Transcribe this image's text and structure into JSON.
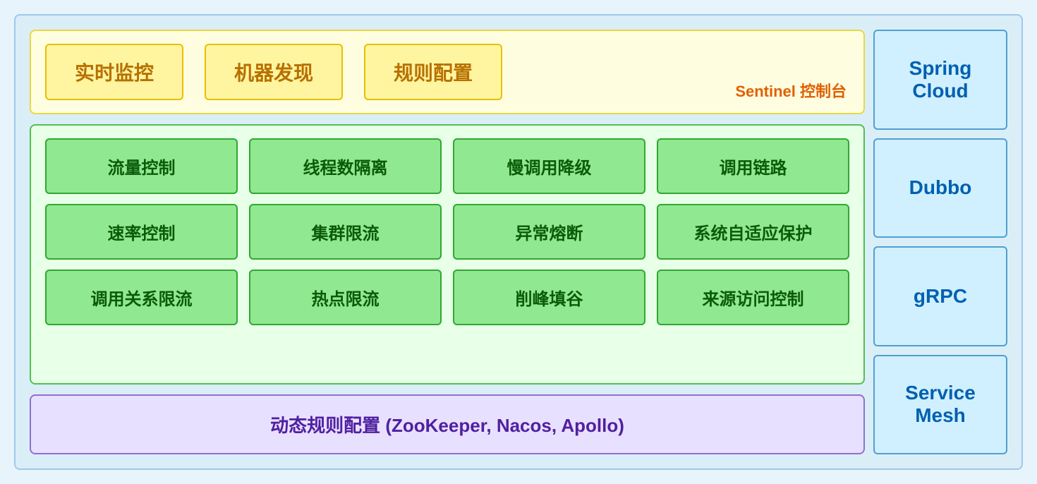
{
  "sentinel": {
    "boxes": [
      {
        "label": "实时监控"
      },
      {
        "label": "机器发现"
      },
      {
        "label": "规则配置"
      }
    ],
    "panel_label": "Sentinel 控制台"
  },
  "features": {
    "rows": [
      [
        {
          "label": "流量控制"
        },
        {
          "label": "线程数隔离"
        },
        {
          "label": "慢调用降级"
        },
        {
          "label": "调用链路"
        }
      ],
      [
        {
          "label": "速率控制"
        },
        {
          "label": "集群限流"
        },
        {
          "label": "异常熔断"
        },
        {
          "label": "系统自适应保护"
        }
      ],
      [
        {
          "label": "调用关系限流"
        },
        {
          "label": "热点限流"
        },
        {
          "label": "削峰填谷"
        },
        {
          "label": "来源访问控制"
        }
      ]
    ]
  },
  "dynamic": {
    "label": "动态规则配置 (ZooKeeper, Nacos, Apollo)"
  },
  "sidebar": {
    "items": [
      {
        "label": "Spring Cloud"
      },
      {
        "label": "Dubbo"
      },
      {
        "label": "gRPC"
      },
      {
        "label": "Service Mesh"
      }
    ]
  }
}
